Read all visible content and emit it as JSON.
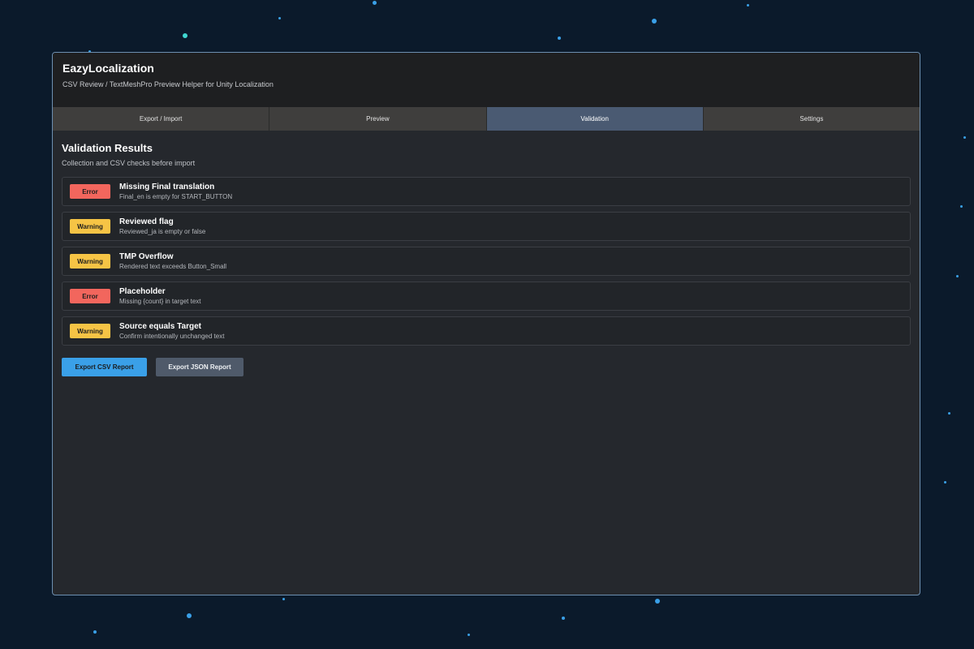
{
  "app": {
    "title": "EazyLocalization",
    "subtitle": "CSV Review / TextMeshPro Preview Helper for Unity Localization"
  },
  "tabs": [
    {
      "label": "Export / Import",
      "active": false
    },
    {
      "label": "Preview",
      "active": false
    },
    {
      "label": "Validation",
      "active": true
    },
    {
      "label": "Settings",
      "active": false
    }
  ],
  "validation": {
    "title": "Validation Results",
    "subtitle": "Collection and CSV checks before import",
    "results": [
      {
        "severity": "Error",
        "title": "Missing Final translation",
        "description": "Final_en is empty for START_BUTTON"
      },
      {
        "severity": "Warning",
        "title": "Reviewed flag",
        "description": "Reviewed_ja is empty or false"
      },
      {
        "severity": "Warning",
        "title": "TMP Overflow",
        "description": "Rendered text exceeds Button_Small"
      },
      {
        "severity": "Error",
        "title": "Placeholder",
        "description": "Missing {count} in target text"
      },
      {
        "severity": "Warning",
        "title": "Source equals Target",
        "description": "Confirm intentionally unchanged text"
      }
    ]
  },
  "actions": {
    "export_csv_label": "Export CSV Report",
    "export_json_label": "Export JSON Report"
  },
  "colors": {
    "background": "#0b1a2b",
    "error": "#f2665d",
    "warning": "#f6c445",
    "accent": "#3aa0e8",
    "active_tab": "#4a5a72"
  }
}
